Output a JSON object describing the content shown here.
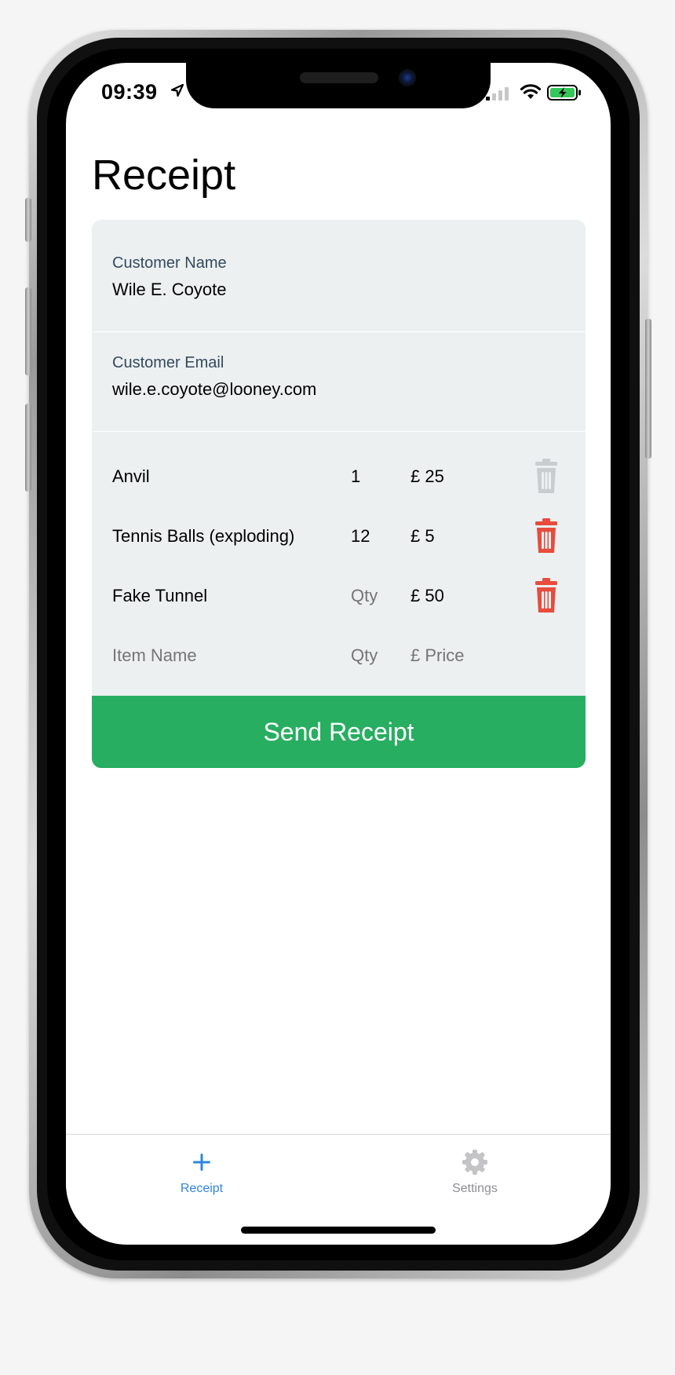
{
  "status_bar": {
    "time": "09:39"
  },
  "page": {
    "title": "Receipt"
  },
  "customer": {
    "name_label": "Customer Name",
    "name_value": "Wile E. Coyote",
    "email_label": "Customer Email",
    "email_value": "wile.e.coyote@looney.com"
  },
  "items": [
    {
      "name": "Anvil",
      "qty": "1",
      "qty_placeholder": "Qty",
      "price": "£ 25",
      "delete_enabled": false
    },
    {
      "name": "Tennis Balls (exploding)",
      "qty": "12",
      "qty_placeholder": "Qty",
      "price": "£ 5",
      "delete_enabled": true
    },
    {
      "name": "Fake Tunnel",
      "qty": "",
      "qty_placeholder": "Qty",
      "price": "£ 50",
      "delete_enabled": true
    }
  ],
  "new_item": {
    "name_placeholder": "Item Name",
    "qty_placeholder": "Qty",
    "price_placeholder": "£ Price"
  },
  "actions": {
    "send_label": "Send Receipt"
  },
  "tab_bar": {
    "tabs": [
      {
        "label": "Receipt",
        "icon": "plus-icon",
        "active": true
      },
      {
        "label": "Settings",
        "icon": "gear-icon",
        "active": false
      }
    ]
  },
  "colors": {
    "accent_green": "#27ae60",
    "card_background": "#ecf0f1",
    "delete_red": "#e74c3c",
    "delete_disabled": "#c8cdd0",
    "tab_active": "#2f86de",
    "tab_inactive": "#8e8e93",
    "label": "#34495e"
  }
}
